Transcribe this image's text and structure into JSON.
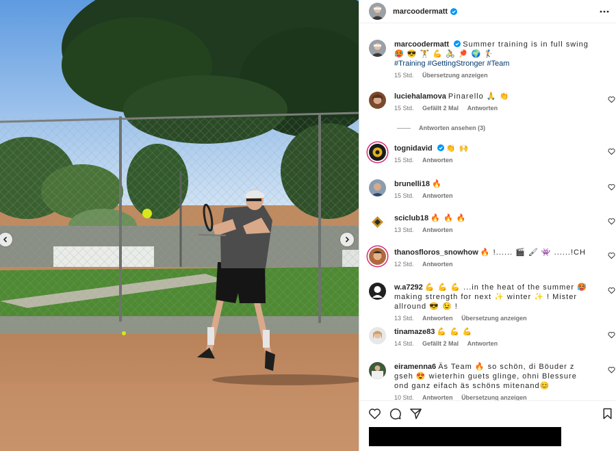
{
  "colors": {
    "accent": "#0095f6",
    "verified": "#0095f6",
    "hashtag": "#00376b",
    "story_ring": "#d62976"
  },
  "photo": {
    "alt_subject": "tennis-player-photo"
  },
  "header": {
    "username": "marcoodermatt",
    "verified": true,
    "more_icon": "more-horizontal-icon"
  },
  "caption": {
    "username": "marcoodermatt",
    "text": "Summer training is in full swing 🥵 😎 🏋 💪 🚴 🏓 🌍 🏌",
    "hashtags": "#Training #GettingStronger #Team",
    "time": "15 Std.",
    "translate": "Übersetzung anzeigen"
  },
  "comments": [
    {
      "username": "luciehalamova",
      "text": "Pinarello 🙏 👏",
      "time": "15 Std.",
      "likes": "Gefällt 2 Mal",
      "reply": "Antworten",
      "verified": false
    },
    {
      "username": "tognidavid",
      "text": "👏 🙌",
      "time": "15 Std.",
      "reply": "Antworten",
      "verified": true
    },
    {
      "username": "brunelli18",
      "text": "🔥",
      "time": "15 Std.",
      "reply": "Antworten",
      "verified": false
    },
    {
      "username": "sciclub18",
      "text": "🔥 🔥 🔥",
      "time": "13 Std.",
      "reply": "Antworten",
      "verified": false
    },
    {
      "username": "thanosfloros_snowhow",
      "text": "🔥 !...... 🎬 🖌 👾 ......!CH",
      "time": "12 Std.",
      "reply": "Antworten",
      "verified": false
    },
    {
      "username": "w.a7292",
      "text": "💪 💪 💪 ...in the heat of the summer 🥵 making strength for next ✨ winter ✨ ! Mister allround 😎 😉 !",
      "time": "13 Std.",
      "reply": "Antworten",
      "translate": "Übersetzung anzeigen",
      "verified": false
    },
    {
      "username": "tinamaze83",
      "text": "💪 💪 💪",
      "time": "14 Std.",
      "likes": "Gefällt 2 Mal",
      "reply": "Antworten",
      "verified": false
    },
    {
      "username": "eiramenna6",
      "text": "Äs Team 🔥 so schön, di Böuder z gseh 😍 wieterhin guets glinge, ohni Blessure ond ganz eifach äs schöns mitenand😊",
      "time": "10 Std.",
      "reply": "Antworten",
      "translate": "Übersetzung anzeigen",
      "verified": false
    }
  ],
  "view_replies": "Antworten ansehen (3)",
  "actions": {
    "like_icon": "heart-icon",
    "comment_icon": "comment-icon",
    "share_icon": "share-icon",
    "save_icon": "bookmark-icon"
  }
}
